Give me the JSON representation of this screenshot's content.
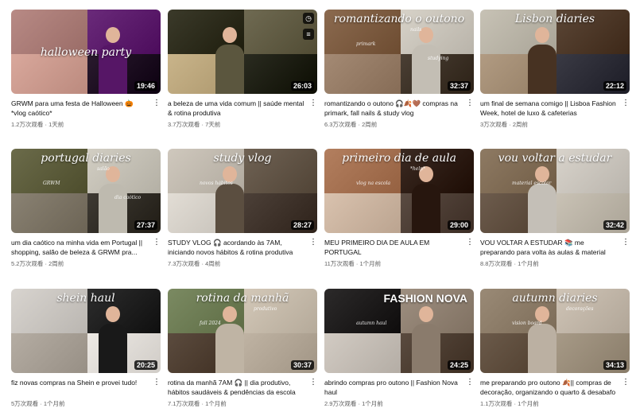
{
  "videos": [
    {
      "title": "GRWM para uma festa de Halloween 🎃 *vlog caótico*",
      "views": "1.2万次观看",
      "age": "1天前",
      "duration": "19:46",
      "overlay": "halloween party",
      "tags": [],
      "colors": [
        "#b88a85",
        "#6a2a7a",
        "#d9a89c",
        "#2a1a2e"
      ]
    },
    {
      "title": "a beleza de uma vida comum || saúde mental & rotina produtiva",
      "views": "3.7万次观看",
      "age": "7天前",
      "duration": "26:03",
      "overlay": "",
      "tags": [],
      "colors": [
        "#3b3a2a",
        "#6f6a52",
        "#c9b48a",
        "#2a2b20"
      ]
    },
    {
      "title": "romantizando o outono 🎧🍂🤎 compras na primark, fall nails & study vlog",
      "views": "6.3万次观看",
      "age": "2周前",
      "duration": "32:37",
      "overlay": "romantizando o outono",
      "tags": [
        "primark",
        "nails",
        "studying"
      ],
      "colors": [
        "#8b6a4f",
        "#d7d2c8",
        "#a48a74",
        "#4a3f34"
      ]
    },
    {
      "title": "um final de semana comigo || Lisboa Fashion Week, hotel de luxo & cafeterias",
      "views": "3万次观看",
      "age": "2周前",
      "duration": "22:12",
      "overlay": "Lisbon diaries",
      "tags": [],
      "colors": [
        "#c7c2b5",
        "#5b4636",
        "#b19b82",
        "#3a3a44"
      ]
    },
    {
      "title": "um dia caótico na minha vida em Portugal || shopping, salão de beleza & GRWM pra...",
      "views": "5.2万次观看",
      "age": "2周前",
      "duration": "27:37",
      "overlay": "portugal diaries",
      "tags": [
        "GRWM",
        "salão",
        "dia caótico"
      ],
      "colors": [
        "#6b6b4a",
        "#d2cec3",
        "#8a8273",
        "#3e3a33"
      ]
    },
    {
      "title": "STUDY VLOG 🎧 acordando às 7AM, iniciando novos hábitos & rotina produtiva",
      "views": "7.3万次观看",
      "age": "4周前",
      "duration": "28:27",
      "overlay": "study vlog",
      "tags": [
        "novos hábitos"
      ],
      "colors": [
        "#cfc8bd",
        "#6f6254",
        "#e2ddd5",
        "#4c4038"
      ]
    },
    {
      "title": "MEU PRIMEIRO DIA DE AULA EM PORTUGAL",
      "views": "11万次观看",
      "age": "1个月前",
      "duration": "29:00",
      "overlay": "primeiro dia de aula",
      "tags": [
        "vlog na escola",
        "*help*"
      ],
      "colors": [
        "#b37f5f",
        "#3b2a22",
        "#d9c2ae",
        "#5a4b42"
      ]
    },
    {
      "title": "VOU VOLTAR A ESTUDAR 📚 me preparando para volta às aulas & material escolar *bac...",
      "views": "8.8万次观看",
      "age": "1个月前",
      "duration": "32:42",
      "overlay": "vou voltar a estudar",
      "tags": [
        "material escolar"
      ],
      "colors": [
        "#8e7a63",
        "#d8d3cb",
        "#6d5c4d",
        "#c9c2b5"
      ]
    },
    {
      "title": "fiz novas compras na Shein e provei tudo!",
      "views": "5万次观看",
      "age": "1个月前",
      "duration": "20:25",
      "overlay": "shein haul",
      "tags": [],
      "colors": [
        "#d8d4cf",
        "#2d2d2d",
        "#b5ada3",
        "#eeeae5"
      ]
    },
    {
      "title": "rotina da manhã 7AM 🎧 || dia produtivo, hábitos saudáveis & pendências da escola",
      "views": "7.1万次观看",
      "age": "1个月前",
      "duration": "30:37",
      "overlay": "rotina da manhã",
      "tags": [
        "fall 2024",
        "produtivo"
      ],
      "colors": [
        "#7b8a62",
        "#d3c8b8",
        "#5b4b3e",
        "#bfb3a3"
      ]
    },
    {
      "title": "abrindo compras pro outono || Fashion Nova haul",
      "views": "2.9万次观看",
      "age": "1个月前",
      "duration": "24:25",
      "overlay": "FASHION NOVA",
      "tags": [
        "autumn haul"
      ],
      "colors": [
        "#2c2a2a",
        "#9e8f80",
        "#d2cbc3",
        "#5a4b3f"
      ]
    },
    {
      "title": "me preparando pro outono 🍂|| compras de decoração, organizando o quarto & desabafo",
      "views": "1.1万次观看",
      "age": "1个月前",
      "duration": "34:13",
      "overlay": "autumn diaries",
      "tags": [
        "vision board",
        "decorações"
      ],
      "colors": [
        "#9a8a76",
        "#cfc4b6",
        "#6b5a4a",
        "#a79a87"
      ]
    }
  ],
  "hover_icons": [
    "clock-icon",
    "playlist-icon"
  ],
  "accent": {
    "duration_bg": "#000000",
    "title": "#0f0f0f",
    "meta": "#606060"
  }
}
